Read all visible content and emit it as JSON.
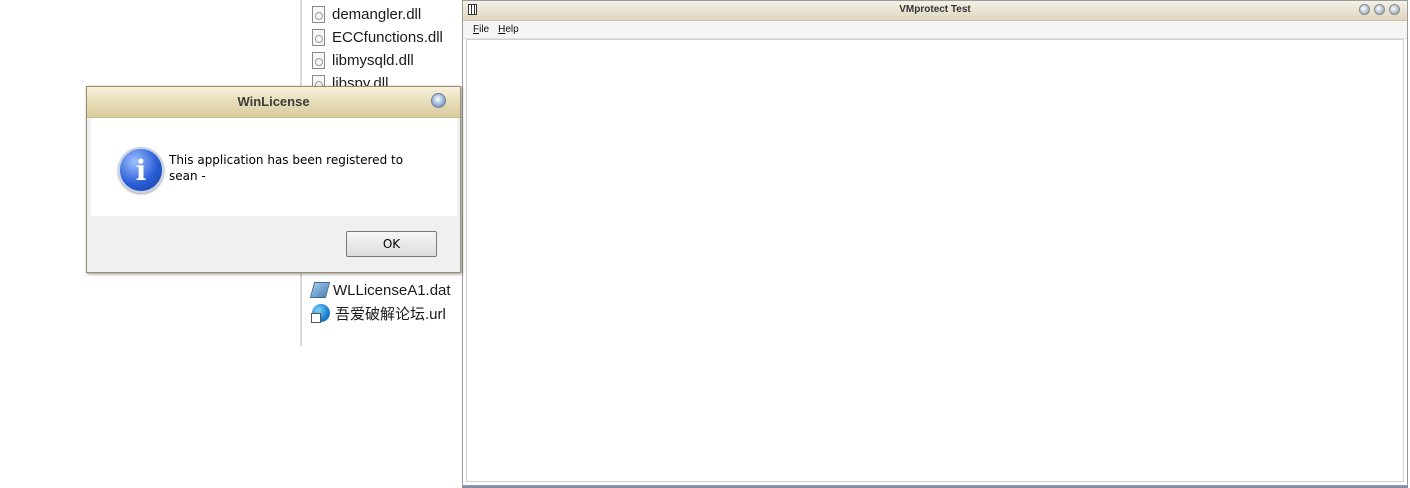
{
  "explorer": {
    "files": [
      {
        "name": "demangler.dll",
        "icon": "dll-file-icon"
      },
      {
        "name": "ECCfunctions.dll",
        "icon": "dll-file-icon"
      },
      {
        "name": "libmysqld.dll",
        "icon": "dll-file-icon"
      },
      {
        "name": "libspy.dll",
        "icon": "dll-file-icon"
      },
      {
        "name": "WLLicenseA1.dat",
        "icon": "dat-file-icon"
      },
      {
        "name": "吾爱破解论坛.url",
        "icon": "url-shortcut-icon"
      }
    ]
  },
  "vm_window": {
    "title": "VMprotect Test",
    "menu": {
      "file": "File",
      "help": "Help"
    }
  },
  "dialog": {
    "title": "WinLicense",
    "message": "This application has been registered to\nsean -",
    "ok_label": "OK",
    "icon": "information-icon"
  },
  "colors": {
    "dialog_title_gradient_top": "#f8f2dc",
    "dialog_title_gradient_bottom": "#d8cc9f",
    "info_icon_blue": "#2a5fd6"
  }
}
